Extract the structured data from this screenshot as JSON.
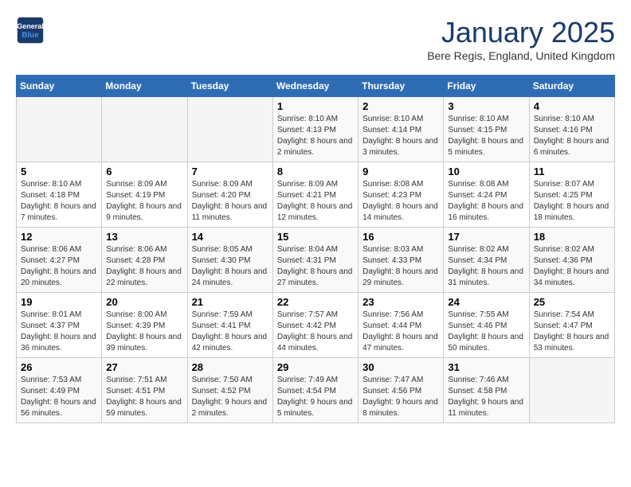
{
  "header": {
    "logo_line1": "General",
    "logo_line2": "Blue",
    "month": "January 2025",
    "location": "Bere Regis, England, United Kingdom"
  },
  "days_of_week": [
    "Sunday",
    "Monday",
    "Tuesday",
    "Wednesday",
    "Thursday",
    "Friday",
    "Saturday"
  ],
  "weeks": [
    [
      {
        "day": "",
        "info": ""
      },
      {
        "day": "",
        "info": ""
      },
      {
        "day": "",
        "info": ""
      },
      {
        "day": "1",
        "info": "Sunrise: 8:10 AM\nSunset: 4:13 PM\nDaylight: 8 hours and 2 minutes."
      },
      {
        "day": "2",
        "info": "Sunrise: 8:10 AM\nSunset: 4:14 PM\nDaylight: 8 hours and 3 minutes."
      },
      {
        "day": "3",
        "info": "Sunrise: 8:10 AM\nSunset: 4:15 PM\nDaylight: 8 hours and 5 minutes."
      },
      {
        "day": "4",
        "info": "Sunrise: 8:10 AM\nSunset: 4:16 PM\nDaylight: 8 hours and 6 minutes."
      }
    ],
    [
      {
        "day": "5",
        "info": "Sunrise: 8:10 AM\nSunset: 4:18 PM\nDaylight: 8 hours and 7 minutes."
      },
      {
        "day": "6",
        "info": "Sunrise: 8:09 AM\nSunset: 4:19 PM\nDaylight: 8 hours and 9 minutes."
      },
      {
        "day": "7",
        "info": "Sunrise: 8:09 AM\nSunset: 4:20 PM\nDaylight: 8 hours and 11 minutes."
      },
      {
        "day": "8",
        "info": "Sunrise: 8:09 AM\nSunset: 4:21 PM\nDaylight: 8 hours and 12 minutes."
      },
      {
        "day": "9",
        "info": "Sunrise: 8:08 AM\nSunset: 4:23 PM\nDaylight: 8 hours and 14 minutes."
      },
      {
        "day": "10",
        "info": "Sunrise: 8:08 AM\nSunset: 4:24 PM\nDaylight: 8 hours and 16 minutes."
      },
      {
        "day": "11",
        "info": "Sunrise: 8:07 AM\nSunset: 4:25 PM\nDaylight: 8 hours and 18 minutes."
      }
    ],
    [
      {
        "day": "12",
        "info": "Sunrise: 8:06 AM\nSunset: 4:27 PM\nDaylight: 8 hours and 20 minutes."
      },
      {
        "day": "13",
        "info": "Sunrise: 8:06 AM\nSunset: 4:28 PM\nDaylight: 8 hours and 22 minutes."
      },
      {
        "day": "14",
        "info": "Sunrise: 8:05 AM\nSunset: 4:30 PM\nDaylight: 8 hours and 24 minutes."
      },
      {
        "day": "15",
        "info": "Sunrise: 8:04 AM\nSunset: 4:31 PM\nDaylight: 8 hours and 27 minutes."
      },
      {
        "day": "16",
        "info": "Sunrise: 8:03 AM\nSunset: 4:33 PM\nDaylight: 8 hours and 29 minutes."
      },
      {
        "day": "17",
        "info": "Sunrise: 8:02 AM\nSunset: 4:34 PM\nDaylight: 8 hours and 31 minutes."
      },
      {
        "day": "18",
        "info": "Sunrise: 8:02 AM\nSunset: 4:36 PM\nDaylight: 8 hours and 34 minutes."
      }
    ],
    [
      {
        "day": "19",
        "info": "Sunrise: 8:01 AM\nSunset: 4:37 PM\nDaylight: 8 hours and 36 minutes."
      },
      {
        "day": "20",
        "info": "Sunrise: 8:00 AM\nSunset: 4:39 PM\nDaylight: 8 hours and 39 minutes."
      },
      {
        "day": "21",
        "info": "Sunrise: 7:59 AM\nSunset: 4:41 PM\nDaylight: 8 hours and 42 minutes."
      },
      {
        "day": "22",
        "info": "Sunrise: 7:57 AM\nSunset: 4:42 PM\nDaylight: 8 hours and 44 minutes."
      },
      {
        "day": "23",
        "info": "Sunrise: 7:56 AM\nSunset: 4:44 PM\nDaylight: 8 hours and 47 minutes."
      },
      {
        "day": "24",
        "info": "Sunrise: 7:55 AM\nSunset: 4:46 PM\nDaylight: 8 hours and 50 minutes."
      },
      {
        "day": "25",
        "info": "Sunrise: 7:54 AM\nSunset: 4:47 PM\nDaylight: 8 hours and 53 minutes."
      }
    ],
    [
      {
        "day": "26",
        "info": "Sunrise: 7:53 AM\nSunset: 4:49 PM\nDaylight: 8 hours and 56 minutes."
      },
      {
        "day": "27",
        "info": "Sunrise: 7:51 AM\nSunset: 4:51 PM\nDaylight: 8 hours and 59 minutes."
      },
      {
        "day": "28",
        "info": "Sunrise: 7:50 AM\nSunset: 4:52 PM\nDaylight: 9 hours and 2 minutes."
      },
      {
        "day": "29",
        "info": "Sunrise: 7:49 AM\nSunset: 4:54 PM\nDaylight: 9 hours and 5 minutes."
      },
      {
        "day": "30",
        "info": "Sunrise: 7:47 AM\nSunset: 4:56 PM\nDaylight: 9 hours and 8 minutes."
      },
      {
        "day": "31",
        "info": "Sunrise: 7:46 AM\nSunset: 4:58 PM\nDaylight: 9 hours and 11 minutes."
      },
      {
        "day": "",
        "info": ""
      }
    ]
  ]
}
